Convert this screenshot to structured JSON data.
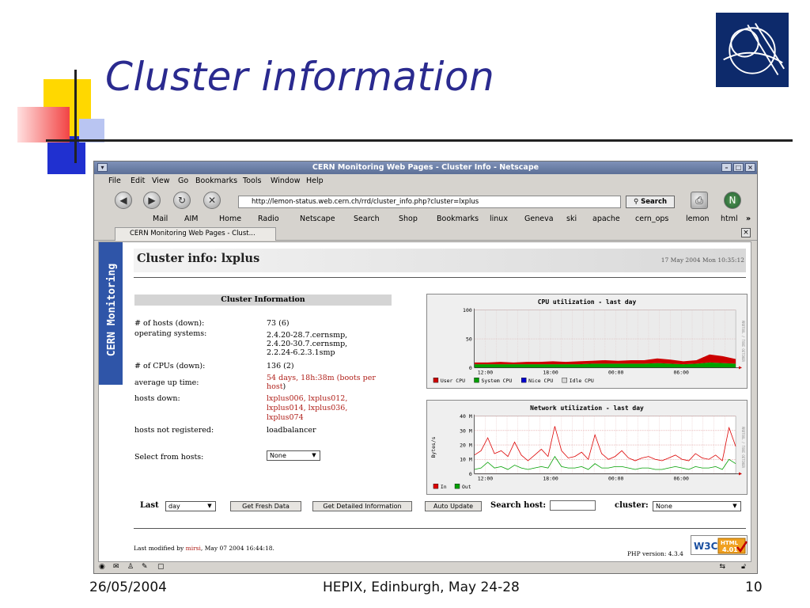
{
  "slide": {
    "title": "Cluster information",
    "footer_date": "26/05/2004",
    "footer_event": "HEPIX, Edinburgh, May 24-28",
    "footer_page": "10",
    "logo_text": "CERN"
  },
  "window": {
    "title": "CERN Monitoring Web Pages - Cluster Info - Netscape",
    "menu": [
      "File",
      "Edit",
      "View",
      "Go",
      "Bookmarks",
      "Tools",
      "Window",
      "Help"
    ],
    "url": "http://lemon-status.web.cern.ch/rrd/cluster_info.php?cluster=lxplus",
    "search_button": "Search",
    "bookmarks": [
      "Mail",
      "AIM",
      "Home",
      "Radio",
      "Netscape",
      "Search",
      "Shop",
      "Bookmarks",
      "linux",
      "Geneva",
      "ski",
      "apache",
      "cern_ops",
      "lemon",
      "html",
      "»"
    ],
    "tab_title": "CERN Monitoring Web Pages - Clust..."
  },
  "page": {
    "sidebar_label": "CERN Monitoring",
    "heading": "Cluster info: lxplus",
    "datetime": "17 May 2004 Mon 10:35:12",
    "section_title": "Cluster Information",
    "info": {
      "hosts_label": "# of hosts (down):",
      "hosts_value": "73 (6)",
      "os_label": "operating systems:",
      "os_values": [
        "2.4.20-28.7.cernsmp,",
        "2.4.20-30.7.cernsmp,",
        "2.2.24-6.2.3.1smp"
      ],
      "cpus_label": "# of CPUs (down):",
      "cpus_value": "136 (2)",
      "uptime_label": "average up time:",
      "uptime_value": "54 days, 18h:38m",
      "uptime_link_1": "(boots per",
      "uptime_link_2": "host",
      "uptime_close": ")",
      "down_label": "hosts down:",
      "down_values": [
        "lxplus006, lxplus012,",
        "lxplus014, lxplus036,",
        "lxplus074"
      ],
      "notreg_label": "hosts not registered:",
      "notreg_value": "loadbalancer",
      "select_label": "Select from hosts:",
      "select_value": "None"
    },
    "controls": {
      "last_label": "Last",
      "last_value": "day",
      "fresh_button": "Get Fresh Data",
      "detail_button": "Get Detailed Information",
      "auto_button": "Auto Update",
      "search_host_label": "Search host:",
      "search_host_value": "",
      "cluster_label": "cluster:",
      "cluster_value": "None"
    },
    "last_modified_prefix": "Last modified by ",
    "last_modified_user": "mirsi",
    "last_modified_suffix": ", May 07 2004 16:44:18.",
    "php_version": "PHP version: 4.3.4",
    "w3c_badge": "W3C HTML 4.01"
  },
  "chart_data": [
    {
      "type": "area",
      "title": "CPU utilization - last day",
      "x_ticks": [
        "12:00",
        "18:00",
        "00:00",
        "06:00"
      ],
      "y_ticks": [
        "0",
        "50",
        "100"
      ],
      "ylim": [
        0,
        100
      ],
      "side_label": "RRDTOOL / TOBI OETIKER",
      "legend": [
        "User CPU",
        "System CPU",
        "Nice CPU",
        "Idle CPU"
      ],
      "colors": [
        "#cc0000",
        "#00a000",
        "#0000cc",
        "#d8d8d8"
      ],
      "series": [
        {
          "name": "User CPU",
          "values": [
            3,
            3,
            4,
            3,
            4,
            4,
            5,
            4,
            5,
            5,
            6,
            5,
            6,
            6,
            8,
            7,
            5,
            6,
            14,
            12,
            8
          ]
        },
        {
          "name": "System CPU",
          "values": [
            6,
            6,
            6,
            6,
            6,
            6,
            6,
            6,
            6,
            7,
            7,
            7,
            7,
            7,
            8,
            7,
            6,
            7,
            9,
            8,
            7
          ]
        },
        {
          "name": "Nice CPU",
          "values": [
            0,
            0,
            0,
            0,
            0,
            0,
            0,
            0,
            0,
            0,
            0,
            0,
            0,
            0,
            0,
            0,
            0,
            0,
            0,
            0,
            0
          ]
        },
        {
          "name": "Idle CPU",
          "values": [
            91,
            91,
            90,
            91,
            90,
            90,
            89,
            90,
            89,
            88,
            87,
            88,
            87,
            87,
            84,
            86,
            89,
            87,
            77,
            80,
            85
          ]
        }
      ]
    },
    {
      "type": "line",
      "title": "Network utilization - last day",
      "ylabel": "Bytes/s",
      "x_ticks": [
        "12:00",
        "18:00",
        "00:00",
        "06:00"
      ],
      "y_ticks": [
        "0",
        "10 M",
        "20 M",
        "30 M",
        "40 M"
      ],
      "ylim": [
        0,
        40
      ],
      "side_label": "RRDTOOL / TOBI OETIKER",
      "legend": [
        "In",
        "Out"
      ],
      "colors": [
        "#dd0000",
        "#00a000"
      ],
      "series": [
        {
          "name": "In",
          "values": [
            13,
            16,
            25,
            14,
            16,
            12,
            22,
            13,
            9,
            13,
            17,
            12,
            33,
            16,
            11,
            12,
            15,
            10,
            27,
            14,
            10,
            12,
            16,
            11,
            9,
            11,
            12,
            10,
            9,
            11,
            13,
            10,
            9,
            14,
            11,
            10,
            13,
            9,
            32,
            19
          ]
        },
        {
          "name": "Out",
          "values": [
            3,
            4,
            8,
            4,
            5,
            3,
            6,
            4,
            3,
            4,
            5,
            4,
            12,
            5,
            4,
            4,
            5,
            3,
            7,
            4,
            4,
            5,
            5,
            4,
            3,
            4,
            4,
            3,
            3,
            4,
            5,
            4,
            3,
            5,
            4,
            4,
            5,
            3,
            10,
            7
          ]
        }
      ]
    }
  ]
}
